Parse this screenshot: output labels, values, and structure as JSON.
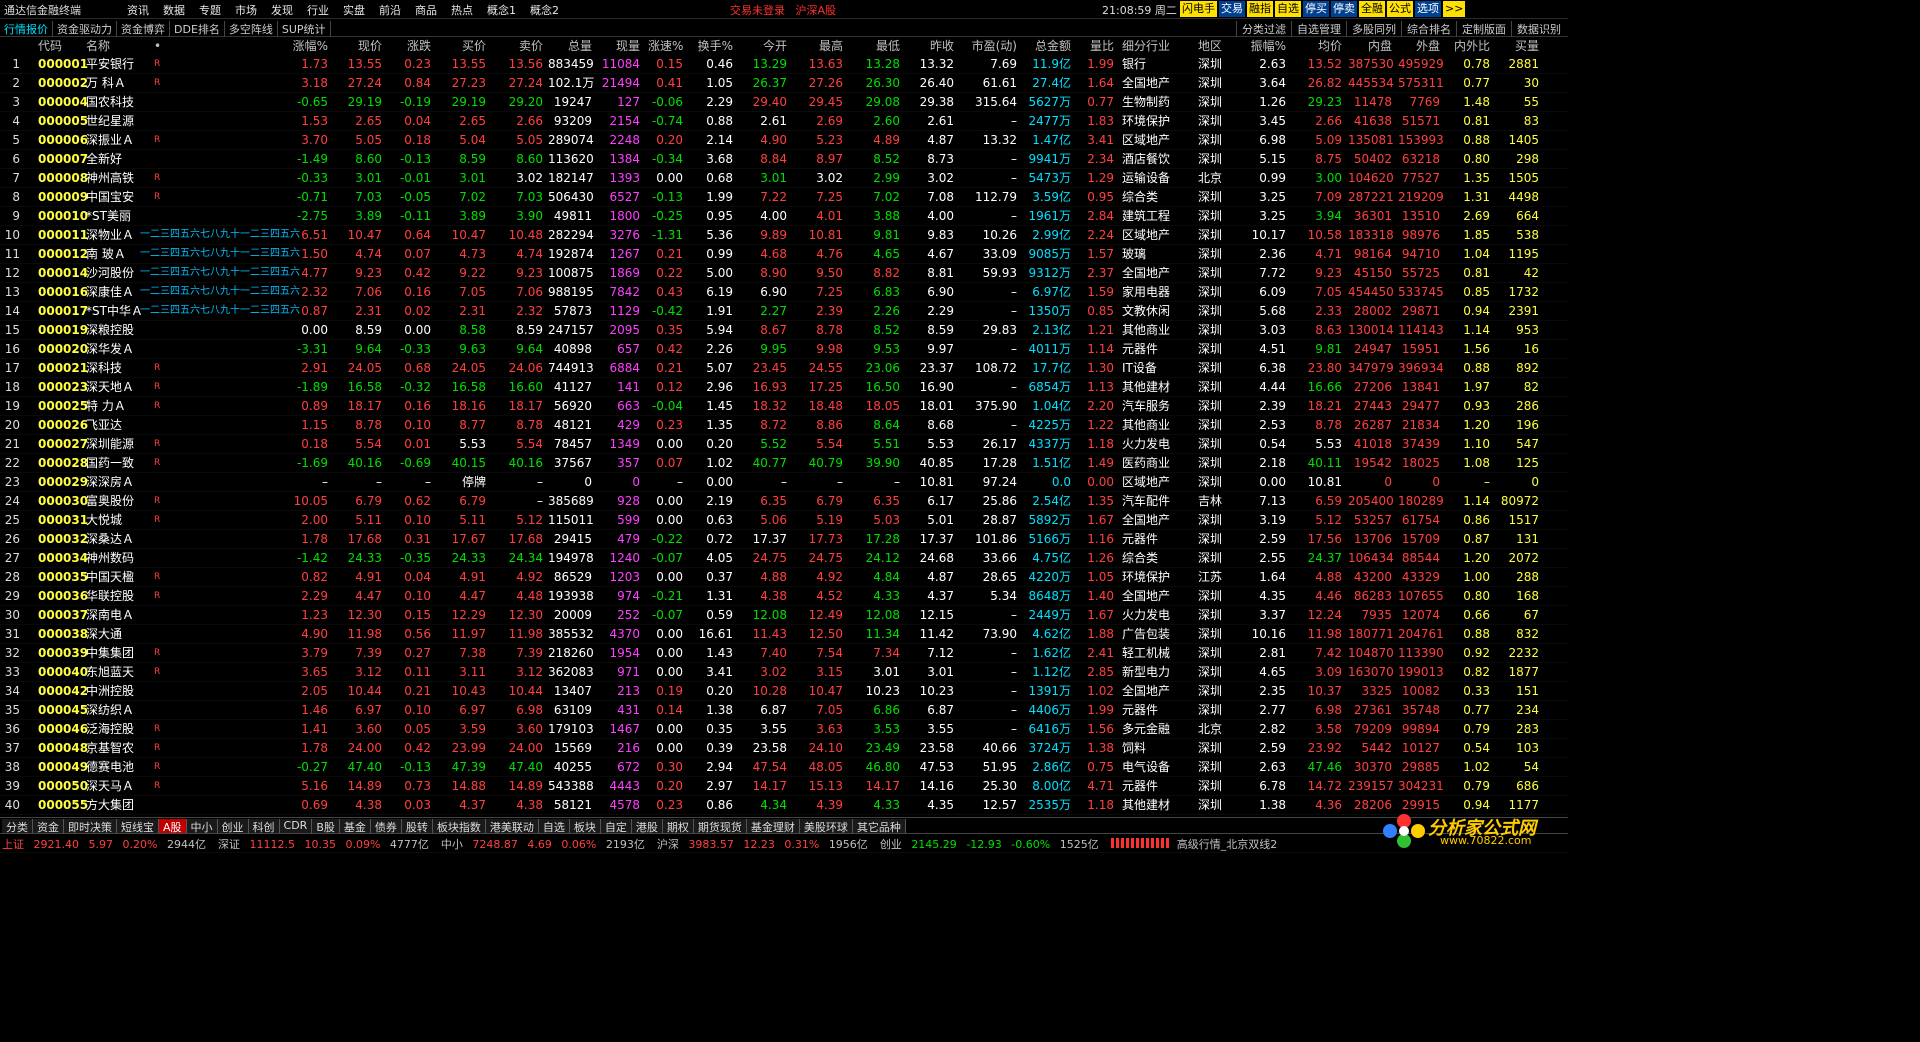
{
  "app": {
    "title": "通达信金融终端"
  },
  "menu": [
    "资讯",
    "数据",
    "专题",
    "市场",
    "发现",
    "行业",
    "实盘",
    "前沿",
    "商品",
    "热点",
    "概念1",
    "概念2"
  ],
  "center": {
    "status": "交易未登录",
    "market": "沪深A股"
  },
  "clock": {
    "time": "21:08:59",
    "day": "周二"
  },
  "topbuttons": [
    "闪电手",
    "交易",
    "融指",
    "自选",
    "停买",
    "停卖",
    "全融",
    "公式",
    "选项",
    ">>"
  ],
  "tabs_left": [
    "行情报价",
    "资金驱动力",
    "资金博弈",
    "DDE排名",
    "多空阵线",
    "SUP统计"
  ],
  "tabs_right": [
    "分类过滤",
    "自选管理",
    "多股同列",
    "综合排名",
    "定制版面",
    "数据识别"
  ],
  "headers": [
    "",
    "代码",
    "名称",
    "•",
    "涨幅%",
    "现价",
    "涨跌",
    "买价",
    "卖价",
    "总量",
    "现量",
    "涨速%",
    "换手%",
    "今开",
    "最高",
    "最低",
    "昨收",
    "市盈(动)",
    "总金额",
    "量比",
    "细分行业",
    "地区",
    "振幅%",
    "均价",
    "内盘",
    "外盘",
    "内外比",
    "买量"
  ],
  "overlay_text": "一二三四五六七八九十一二三四五六",
  "rows": [
    [
      "1",
      "000001",
      "平安银行",
      "R",
      "1.73",
      "13.55",
      "0.23",
      "13.55",
      "13.56",
      "883459",
      "11084",
      "0.15",
      "0.46",
      "13.29",
      "13.63",
      "13.28",
      "13.32",
      "7.69",
      "11.9亿",
      "1.99",
      "银行",
      "深圳",
      "2.63",
      "13.52",
      "387530",
      "495929",
      "0.78",
      "2881"
    ],
    [
      "2",
      "000002",
      "万 科Ａ",
      "R",
      "3.18",
      "27.24",
      "0.84",
      "27.23",
      "27.24",
      "102.1万",
      "21494",
      "0.41",
      "1.05",
      "26.37",
      "27.26",
      "26.30",
      "26.40",
      "61.61",
      "27.4亿",
      "1.64",
      "全国地产",
      "深圳",
      "3.64",
      "26.82",
      "445534",
      "575311",
      "0.77",
      "30"
    ],
    [
      "3",
      "000004",
      "国农科技",
      "",
      "-0.65",
      "29.19",
      "-0.19",
      "29.19",
      "29.20",
      "19247",
      "127",
      "-0.06",
      "2.29",
      "29.40",
      "29.45",
      "29.08",
      "29.38",
      "315.64",
      "5627万",
      "0.77",
      "生物制药",
      "深圳",
      "1.26",
      "29.23",
      "11478",
      "7769",
      "1.48",
      "55"
    ],
    [
      "4",
      "000005",
      "世纪星源",
      "",
      "1.53",
      "2.65",
      "0.04",
      "2.65",
      "2.66",
      "93209",
      "2154",
      "-0.74",
      "0.88",
      "2.61",
      "2.69",
      "2.60",
      "2.61",
      "–",
      "2477万",
      "1.83",
      "环境保护",
      "深圳",
      "3.45",
      "2.66",
      "41638",
      "51571",
      "0.81",
      "83"
    ],
    [
      "5",
      "000006",
      "深振业Ａ",
      "R",
      "3.70",
      "5.05",
      "0.18",
      "5.04",
      "5.05",
      "289074",
      "2248",
      "0.20",
      "2.14",
      "4.90",
      "5.23",
      "4.89",
      "4.87",
      "13.32",
      "1.47亿",
      "3.41",
      "区域地产",
      "深圳",
      "6.98",
      "5.09",
      "135081",
      "153993",
      "0.88",
      "1405"
    ],
    [
      "6",
      "000007",
      "全新好",
      "",
      "-1.49",
      "8.60",
      "-0.13",
      "8.59",
      "8.60",
      "113620",
      "1384",
      "-0.34",
      "3.68",
      "8.84",
      "8.97",
      "8.52",
      "8.73",
      "–",
      "9941万",
      "2.34",
      "酒店餐饮",
      "深圳",
      "5.15",
      "8.75",
      "50402",
      "63218",
      "0.80",
      "298"
    ],
    [
      "7",
      "000008",
      "神州高铁",
      "R",
      "-0.33",
      "3.01",
      "-0.01",
      "3.01",
      "3.02",
      "182147",
      "1393",
      "0.00",
      "0.68",
      "3.01",
      "3.02",
      "2.99",
      "3.02",
      "–",
      "5473万",
      "1.29",
      "运输设备",
      "北京",
      "0.99",
      "3.00",
      "104620",
      "77527",
      "1.35",
      "1505"
    ],
    [
      "8",
      "000009",
      "中国宝安",
      "R",
      "-0.71",
      "7.03",
      "-0.05",
      "7.02",
      "7.03",
      "506430",
      "6527",
      "-0.13",
      "1.99",
      "7.22",
      "7.25",
      "7.02",
      "7.08",
      "112.79",
      "3.59亿",
      "0.95",
      "综合类",
      "深圳",
      "3.25",
      "7.09",
      "287221",
      "219209",
      "1.31",
      "4498"
    ],
    [
      "9",
      "000010",
      "*ST美丽",
      "",
      "-2.75",
      "3.89",
      "-0.11",
      "3.89",
      "3.90",
      "49811",
      "1800",
      "-0.25",
      "0.95",
      "4.00",
      "4.01",
      "3.88",
      "4.00",
      "–",
      "1961万",
      "2.84",
      "建筑工程",
      "深圳",
      "3.25",
      "3.94",
      "36301",
      "13510",
      "2.69",
      "664"
    ],
    [
      "10",
      "000011",
      "深物业Ａ",
      "",
      "6.51",
      "10.47",
      "0.64",
      "10.47",
      "10.48",
      "282294",
      "3276",
      "-1.31",
      "5.36",
      "9.89",
      "10.81",
      "9.81",
      "9.83",
      "10.26",
      "2.99亿",
      "2.24",
      "区域地产",
      "深圳",
      "10.17",
      "10.58",
      "183318",
      "98976",
      "1.85",
      "538"
    ],
    [
      "11",
      "000012",
      "南 玻Ａ",
      "",
      "1.50",
      "4.74",
      "0.07",
      "4.73",
      "4.74",
      "192874",
      "1267",
      "0.21",
      "0.99",
      "4.68",
      "4.76",
      "4.65",
      "4.67",
      "33.09",
      "9085万",
      "1.57",
      "玻璃",
      "深圳",
      "2.36",
      "4.71",
      "98164",
      "94710",
      "1.04",
      "1195"
    ],
    [
      "12",
      "000014",
      "沙河股份",
      "",
      "4.77",
      "9.23",
      "0.42",
      "9.22",
      "9.23",
      "100875",
      "1869",
      "0.22",
      "5.00",
      "8.90",
      "9.50",
      "8.82",
      "8.81",
      "59.93",
      "9312万",
      "2.37",
      "全国地产",
      "深圳",
      "7.72",
      "9.23",
      "45150",
      "55725",
      "0.81",
      "42"
    ],
    [
      "13",
      "000016",
      "深康佳Ａ",
      "",
      "2.32",
      "7.06",
      "0.16",
      "7.05",
      "7.06",
      "988195",
      "7842",
      "0.43",
      "6.19",
      "6.90",
      "7.25",
      "6.83",
      "6.90",
      "–",
      "6.97亿",
      "1.59",
      "家用电器",
      "深圳",
      "6.09",
      "7.05",
      "454450",
      "533745",
      "0.85",
      "1732"
    ],
    [
      "14",
      "000017",
      "*ST中华Ａ",
      "",
      "0.87",
      "2.31",
      "0.02",
      "2.31",
      "2.32",
      "57873",
      "1129",
      "-0.42",
      "1.91",
      "2.27",
      "2.39",
      "2.26",
      "2.29",
      "–",
      "1350万",
      "0.85",
      "文教休闲",
      "深圳",
      "5.68",
      "2.33",
      "28002",
      "29871",
      "0.94",
      "2391"
    ],
    [
      "15",
      "000019",
      "深粮控股",
      "",
      "0.00",
      "8.59",
      "0.00",
      "8.58",
      "8.59",
      "247157",
      "2095",
      "0.35",
      "5.94",
      "8.67",
      "8.78",
      "8.52",
      "8.59",
      "29.83",
      "2.13亿",
      "1.21",
      "其他商业",
      "深圳",
      "3.03",
      "8.63",
      "130014",
      "114143",
      "1.14",
      "953"
    ],
    [
      "16",
      "000020",
      "深华发Ａ",
      "",
      "-3.31",
      "9.64",
      "-0.33",
      "9.63",
      "9.64",
      "40898",
      "657",
      "0.42",
      "2.26",
      "9.95",
      "9.98",
      "9.53",
      "9.97",
      "–",
      "4011万",
      "1.14",
      "元器件",
      "深圳",
      "4.51",
      "9.81",
      "24947",
      "15951",
      "1.56",
      "16"
    ],
    [
      "17",
      "000021",
      "深科技",
      "R",
      "2.91",
      "24.05",
      "0.68",
      "24.05",
      "24.06",
      "744913",
      "6884",
      "0.21",
      "5.07",
      "23.45",
      "24.55",
      "23.06",
      "23.37",
      "108.72",
      "17.7亿",
      "1.30",
      "IT设备",
      "深圳",
      "6.38",
      "23.80",
      "347979",
      "396934",
      "0.88",
      "892"
    ],
    [
      "18",
      "000023",
      "深天地Ａ",
      "R",
      "-1.89",
      "16.58",
      "-0.32",
      "16.58",
      "16.60",
      "41127",
      "141",
      "0.12",
      "2.96",
      "16.93",
      "17.25",
      "16.50",
      "16.90",
      "–",
      "6854万",
      "1.13",
      "其他建材",
      "深圳",
      "4.44",
      "16.66",
      "27206",
      "13841",
      "1.97",
      "82"
    ],
    [
      "19",
      "000025",
      "特 力Ａ",
      "R",
      "0.89",
      "18.17",
      "0.16",
      "18.16",
      "18.17",
      "56920",
      "663",
      "-0.04",
      "1.45",
      "18.32",
      "18.48",
      "18.05",
      "18.01",
      "375.90",
      "1.04亿",
      "2.20",
      "汽车服务",
      "深圳",
      "2.39",
      "18.21",
      "27443",
      "29477",
      "0.93",
      "286"
    ],
    [
      "20",
      "000026",
      "飞亚达",
      "",
      "1.15",
      "8.78",
      "0.10",
      "8.77",
      "8.78",
      "48121",
      "429",
      "0.23",
      "1.35",
      "8.72",
      "8.86",
      "8.64",
      "8.68",
      "–",
      "4225万",
      "1.22",
      "其他商业",
      "深圳",
      "2.53",
      "8.78",
      "26287",
      "21834",
      "1.20",
      "196"
    ],
    [
      "21",
      "000027",
      "深圳能源",
      "R",
      "0.18",
      "5.54",
      "0.01",
      "5.53",
      "5.54",
      "78457",
      "1349",
      "0.00",
      "0.20",
      "5.52",
      "5.54",
      "5.51",
      "5.53",
      "26.17",
      "4337万",
      "1.18",
      "火力发电",
      "深圳",
      "0.54",
      "5.53",
      "41018",
      "37439",
      "1.10",
      "547"
    ],
    [
      "22",
      "000028",
      "国药一致",
      "R",
      "-1.69",
      "40.16",
      "-0.69",
      "40.15",
      "40.16",
      "37567",
      "357",
      "0.07",
      "1.02",
      "40.77",
      "40.79",
      "39.90",
      "40.85",
      "17.28",
      "1.51亿",
      "1.49",
      "医药商业",
      "深圳",
      "2.18",
      "40.11",
      "19542",
      "18025",
      "1.08",
      "125"
    ],
    [
      "23",
      "000029",
      "深深房Ａ",
      "",
      "–",
      "–",
      "–",
      "停牌",
      "–",
      "0",
      "0",
      "–",
      "0.00",
      "–",
      "–",
      "–",
      "10.81",
      "97.24",
      "0.0",
      "0.00",
      "区域地产",
      "深圳",
      "0.00",
      "10.81",
      "0",
      "0",
      "–",
      "0"
    ],
    [
      "24",
      "000030",
      "富奥股份",
      "R",
      "10.05",
      "6.79",
      "0.62",
      "6.79",
      "–",
      "385689",
      "928",
      "0.00",
      "2.19",
      "6.35",
      "6.79",
      "6.35",
      "6.17",
      "25.86",
      "2.54亿",
      "1.35",
      "汽车配件",
      "吉林",
      "7.13",
      "6.59",
      "205400",
      "180289",
      "1.14",
      "80972"
    ],
    [
      "25",
      "000031",
      "大悦城",
      "R",
      "2.00",
      "5.11",
      "0.10",
      "5.11",
      "5.12",
      "115011",
      "599",
      "0.00",
      "0.63",
      "5.06",
      "5.19",
      "5.03",
      "5.01",
      "28.87",
      "5892万",
      "1.67",
      "全国地产",
      "深圳",
      "3.19",
      "5.12",
      "53257",
      "61754",
      "0.86",
      "1517"
    ],
    [
      "26",
      "000032",
      "深桑达Ａ",
      "",
      "1.78",
      "17.68",
      "0.31",
      "17.67",
      "17.68",
      "29415",
      "479",
      "-0.22",
      "0.72",
      "17.37",
      "17.73",
      "17.28",
      "17.37",
      "101.86",
      "5166万",
      "1.16",
      "元器件",
      "深圳",
      "2.59",
      "17.56",
      "13706",
      "15709",
      "0.87",
      "131"
    ],
    [
      "27",
      "000034",
      "神州数码",
      "",
      "-1.42",
      "24.33",
      "-0.35",
      "24.33",
      "24.34",
      "194978",
      "1240",
      "-0.07",
      "4.05",
      "24.75",
      "24.75",
      "24.12",
      "24.68",
      "33.66",
      "4.75亿",
      "1.26",
      "综合类",
      "深圳",
      "2.55",
      "24.37",
      "106434",
      "88544",
      "1.20",
      "2072"
    ],
    [
      "28",
      "000035",
      "中国天楹",
      "R",
      "0.82",
      "4.91",
      "0.04",
      "4.91",
      "4.92",
      "86529",
      "1203",
      "0.00",
      "0.37",
      "4.88",
      "4.92",
      "4.84",
      "4.87",
      "28.65",
      "4220万",
      "1.05",
      "环境保护",
      "江苏",
      "1.64",
      "4.88",
      "43200",
      "43329",
      "1.00",
      "288"
    ],
    [
      "29",
      "000036",
      "华联控股",
      "R",
      "2.29",
      "4.47",
      "0.10",
      "4.47",
      "4.48",
      "193938",
      "974",
      "-0.21",
      "1.31",
      "4.38",
      "4.52",
      "4.33",
      "4.37",
      "5.34",
      "8648万",
      "1.40",
      "全国地产",
      "深圳",
      "4.35",
      "4.46",
      "86283",
      "107655",
      "0.80",
      "168"
    ],
    [
      "30",
      "000037",
      "深南电Ａ",
      "",
      "1.23",
      "12.30",
      "0.15",
      "12.29",
      "12.30",
      "20009",
      "252",
      "-0.07",
      "0.59",
      "12.08",
      "12.49",
      "12.08",
      "12.15",
      "–",
      "2449万",
      "1.67",
      "火力发电",
      "深圳",
      "3.37",
      "12.24",
      "7935",
      "12074",
      "0.66",
      "67"
    ],
    [
      "31",
      "000038",
      "深大通",
      "",
      "4.90",
      "11.98",
      "0.56",
      "11.97",
      "11.98",
      "385532",
      "4370",
      "0.00",
      "16.61",
      "11.43",
      "12.50",
      "11.34",
      "11.42",
      "73.90",
      "4.62亿",
      "1.88",
      "广告包装",
      "深圳",
      "10.16",
      "11.98",
      "180771",
      "204761",
      "0.88",
      "832"
    ],
    [
      "32",
      "000039",
      "中集集团",
      "R",
      "3.79",
      "7.39",
      "0.27",
      "7.38",
      "7.39",
      "218260",
      "1954",
      "0.00",
      "1.43",
      "7.40",
      "7.54",
      "7.34",
      "7.12",
      "–",
      "1.62亿",
      "2.41",
      "轻工机械",
      "深圳",
      "2.81",
      "7.42",
      "104870",
      "113390",
      "0.92",
      "2232"
    ],
    [
      "33",
      "000040",
      "东旭蓝天",
      "R",
      "3.65",
      "3.12",
      "0.11",
      "3.11",
      "3.12",
      "362083",
      "971",
      "0.00",
      "3.41",
      "3.02",
      "3.15",
      "3.01",
      "3.01",
      "–",
      "1.12亿",
      "2.85",
      "新型电力",
      "深圳",
      "4.65",
      "3.09",
      "163070",
      "199013",
      "0.82",
      "1877"
    ],
    [
      "34",
      "000042",
      "中洲控股",
      "",
      "2.05",
      "10.44",
      "0.21",
      "10.43",
      "10.44",
      "13407",
      "213",
      "0.19",
      "0.20",
      "10.28",
      "10.47",
      "10.23",
      "10.23",
      "–",
      "1391万",
      "1.02",
      "全国地产",
      "深圳",
      "2.35",
      "10.37",
      "3325",
      "10082",
      "0.33",
      "151"
    ],
    [
      "35",
      "000045",
      "深纺织Ａ",
      "",
      "1.46",
      "6.97",
      "0.10",
      "6.97",
      "6.98",
      "63109",
      "431",
      "0.14",
      "1.38",
      "6.87",
      "7.05",
      "6.86",
      "6.87",
      "–",
      "4406万",
      "1.99",
      "元器件",
      "深圳",
      "2.77",
      "6.98",
      "27361",
      "35748",
      "0.77",
      "234"
    ],
    [
      "36",
      "000046",
      "泛海控股",
      "R",
      "1.41",
      "3.60",
      "0.05",
      "3.59",
      "3.60",
      "179103",
      "1467",
      "0.00",
      "0.35",
      "3.55",
      "3.63",
      "3.53",
      "3.55",
      "–",
      "6416万",
      "1.56",
      "多元金融",
      "北京",
      "2.82",
      "3.58",
      "79209",
      "99894",
      "0.79",
      "283"
    ],
    [
      "37",
      "000048",
      "京基智农",
      "R",
      "1.78",
      "24.00",
      "0.42",
      "23.99",
      "24.00",
      "15569",
      "216",
      "0.00",
      "0.39",
      "23.58",
      "24.10",
      "23.49",
      "23.58",
      "40.66",
      "3724万",
      "1.38",
      "饲料",
      "深圳",
      "2.59",
      "23.92",
      "5442",
      "10127",
      "0.54",
      "103"
    ],
    [
      "38",
      "000049",
      "德赛电池",
      "R",
      "-0.27",
      "47.40",
      "-0.13",
      "47.39",
      "47.40",
      "40255",
      "672",
      "0.30",
      "2.94",
      "47.54",
      "48.05",
      "46.80",
      "47.53",
      "51.95",
      "2.86亿",
      "0.75",
      "电气设备",
      "深圳",
      "2.63",
      "47.46",
      "30370",
      "29885",
      "1.02",
      "54"
    ],
    [
      "39",
      "000050",
      "深天马Ａ",
      "R",
      "5.16",
      "14.89",
      "0.73",
      "14.88",
      "14.89",
      "543388",
      "4443",
      "0.20",
      "2.97",
      "14.17",
      "15.13",
      "14.17",
      "14.16",
      "25.30",
      "8.00亿",
      "4.71",
      "元器件",
      "深圳",
      "6.78",
      "14.72",
      "239157",
      "304231",
      "0.79",
      "686"
    ],
    [
      "40",
      "000055",
      "方大集团",
      "",
      "0.69",
      "4.38",
      "0.03",
      "4.37",
      "4.38",
      "58121",
      "4578",
      "0.23",
      "0.86",
      "4.34",
      "4.39",
      "4.33",
      "4.35",
      "12.57",
      "2535万",
      "1.18",
      "其他建材",
      "深圳",
      "1.38",
      "4.36",
      "28206",
      "29915",
      "0.94",
      "1177"
    ],
    [
      "41",
      "000056",
      "皇庭国际",
      "",
      "3.25",
      "3.49",
      "0.11",
      "3.48",
      "3.49",
      "66703",
      "3164",
      "0.58",
      "0.74",
      "3.37",
      "3.50",
      "3.37",
      "3.38",
      "340.16",
      "2300万",
      "2.70",
      "房产服务",
      "深圳",
      "3.85",
      "3.45",
      "27371",
      "39332",
      "0.70",
      "115"
    ],
    [
      "42",
      "000058",
      "深 赛 格",
      "",
      "2.96",
      "6.60",
      "0.19",
      "6.60",
      "6.61",
      "292250",
      "2315",
      "0.00",
      "5.43",
      "6.44",
      "6.74",
      "6.41",
      "6.41",
      "–",
      "1.94亿",
      "2.51",
      "元器件",
      "深圳",
      "5.15",
      "6.63",
      "134840",
      "157410",
      "0.86",
      "3538"
    ]
  ],
  "bottom_tabs": [
    "分类",
    "资金",
    "即时决策",
    "短线宝",
    "A股",
    "中小",
    "创业",
    "科创",
    "CDR",
    "B股",
    "基金",
    "债券",
    "股转",
    "板块指数",
    "港美联动",
    "自选",
    "板块",
    "自定",
    "港股",
    "期权",
    "期货现货",
    "基金理财",
    "美股环球",
    "其它品种"
  ],
  "status": {
    "sh_label": "上证",
    "sh_val": "2921.40",
    "sh_chg": "5.97",
    "sh_pct": "0.20%",
    "sh_amt": "2944亿",
    "sz_label": "深证",
    "sz_val": "11112.5",
    "sz_chg": "10.35",
    "sz_pct": "0.09%",
    "sz_amt": "4777亿",
    "zx_label": "中小",
    "zx_val": "7248.87",
    "zx_chg": "4.69",
    "zx_pct": "0.06%",
    "zx_amt": "2193亿",
    "hs_label": "沪深",
    "hs_val": "3983.57",
    "hs_chg": "12.23",
    "hs_pct": "0.31%",
    "hs_amt": "1956亿",
    "cy_label": "创业",
    "cy_val": "2145.29",
    "cy_chg": "-12.93",
    "cy_pct": "-0.60%",
    "cy_amt": "1525亿",
    "feed": "高级行情_北京双线2"
  },
  "logo": {
    "brand": "分析家公式网",
    "url": "www.70822.com"
  },
  "colors": {
    "up": "#ff4040",
    "down": "#00e000",
    "flat": "#ffffff",
    "code": "#ffff40",
    "accent": "#00e0ff",
    "bg": "#000000"
  }
}
